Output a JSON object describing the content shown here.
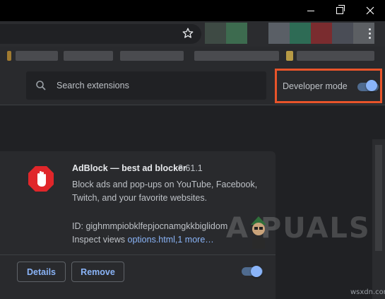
{
  "window": {
    "minimize_icon": "minimize-icon",
    "maximize_icon": "restore-icon",
    "close_icon": "close-icon"
  },
  "toolbar": {
    "bookmark_icon": "star-icon",
    "menu_icon": "kebab-menu-icon",
    "extension_colors": [
      "#3e4a44",
      "#3d6b4f",
      "#2b2c2f",
      "#5a5f66",
      "#2e6b55",
      "#7a2c2f",
      "#4a4d56",
      "#5c5f63"
    ]
  },
  "header": {
    "search": {
      "placeholder": "Search extensions",
      "icon": "search-icon"
    },
    "developer_mode": {
      "label": "Developer mode",
      "enabled": true
    }
  },
  "extension": {
    "name": "AdBlock — best ad blocker",
    "version": "3.61.1",
    "description": "Block ads and pop-ups on YouTube, Facebook, Twitch, and your favorite websites.",
    "id_line": "ID: gighmmpiobklfepjocnamgkkbiglidom",
    "inspect_prefix": "Inspect views",
    "inspect_link": "options.html,1 more…",
    "details_label": "Details",
    "remove_label": "Remove",
    "enabled": true,
    "icon": "adblock-hand-icon",
    "icon_color": "#e0262a"
  },
  "watermark": {
    "text": "A  PUALS",
    "site": "wsxdn.com"
  },
  "colors": {
    "accent": "#8ab4f8",
    "highlight": "#e8542a",
    "background": "#202124"
  }
}
